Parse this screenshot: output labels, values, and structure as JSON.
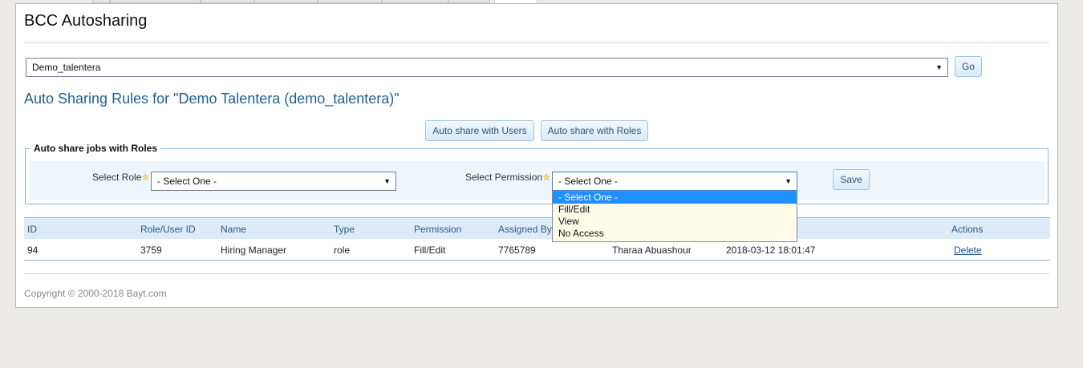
{
  "page": {
    "title": "BCC Autosharing"
  },
  "company_select": {
    "value": "Demo_talentera"
  },
  "go_button": "Go",
  "rules_heading": "Auto Sharing Rules for \"Demo Talentera (demo_talentera)\"",
  "share_buttons": {
    "users": "Auto share with Users",
    "roles": "Auto share with Roles"
  },
  "roles_form": {
    "legend": "Auto share jobs with Roles",
    "role_label": "Select Role",
    "role_value": "- Select One -",
    "permission_label": "Select Permission",
    "permission_value": "- Select One -",
    "permission_options": [
      "- Select One -",
      "Fill/Edit",
      "View",
      "No Access"
    ],
    "save_label": "Save"
  },
  "table": {
    "headers": {
      "id": "ID",
      "role_user_id": "Role/User ID",
      "name": "Name",
      "type": "Type",
      "permission": "Permission",
      "assigned_by": "Assigned By",
      "actions": "Actions"
    },
    "rows": [
      {
        "id": "94",
        "role_user_id": "3759",
        "name": "Hiring Manager",
        "type": "role",
        "permission": "Fill/Edit",
        "assigned_by": "7765789",
        "assigned_name": "Tharaa Abuashour",
        "date": "2018-03-12 18:01:47",
        "action": "Delete"
      }
    ]
  },
  "footer": {
    "copyright": "Copyright © 2000-2018 Bayt.com"
  },
  "colors": {
    "accent": "#1f5f94",
    "selected_option": "#1e90ff",
    "table_header_bg": "#dcebf7"
  }
}
